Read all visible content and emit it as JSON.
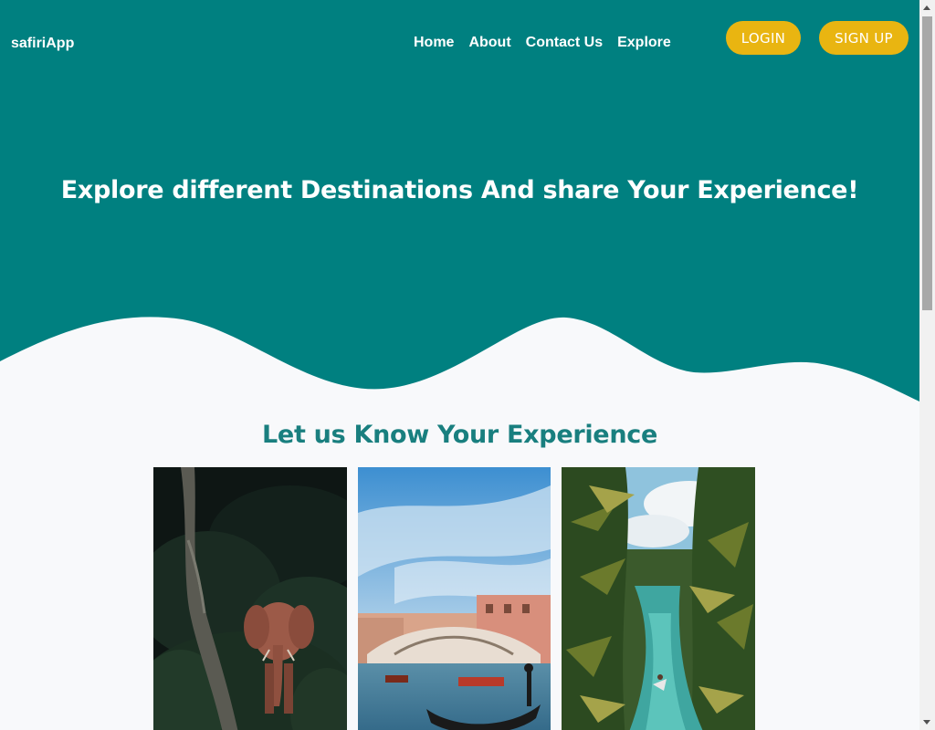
{
  "brand": "safiriApp",
  "nav": {
    "items": [
      {
        "label": "Home"
      },
      {
        "label": "About"
      },
      {
        "label": "Contact Us"
      },
      {
        "label": "Explore"
      }
    ]
  },
  "auth": {
    "login_label": "LOGIN",
    "signup_label": "SIGN UP"
  },
  "hero": {
    "title": "Explore different Destinations And share Your Experience!"
  },
  "experience": {
    "title": "Let us Know Your Experience",
    "photos": [
      {
        "subject": "elephant in forest"
      },
      {
        "subject": "Rialto bridge Venice"
      },
      {
        "subject": "palm tree river"
      }
    ]
  },
  "colors": {
    "hero_bg": "#008080",
    "accent": "#e9b511",
    "section_title": "#197f7f",
    "page_bg": "#f8f9fb"
  }
}
